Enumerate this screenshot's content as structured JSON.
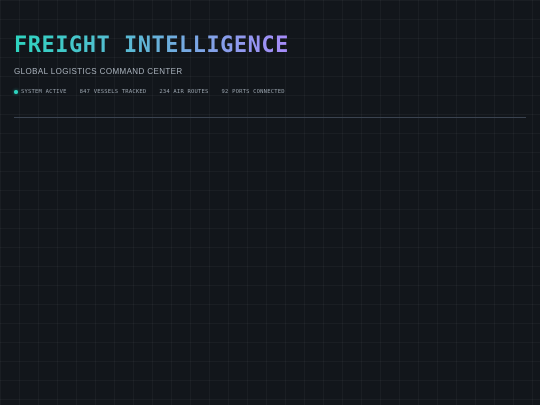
{
  "header": {
    "title": "FREIGHT INTELLIGENCE",
    "subtitle": "GLOBAL LOGISTICS COMMAND CENTER"
  },
  "status": {
    "system": "SYSTEM ACTIVE",
    "vessels": "847 VESSELS TRACKED",
    "air_routes": "234 AIR ROUTES",
    "ports": "92 PORTS CONNECTED",
    "indicator_color": "#2dd4bf"
  },
  "colors": {
    "background": "#12161b",
    "title_gradient_start": "#2dd4bf",
    "title_gradient_end": "#a78bfa",
    "divider": "#3a4350"
  }
}
